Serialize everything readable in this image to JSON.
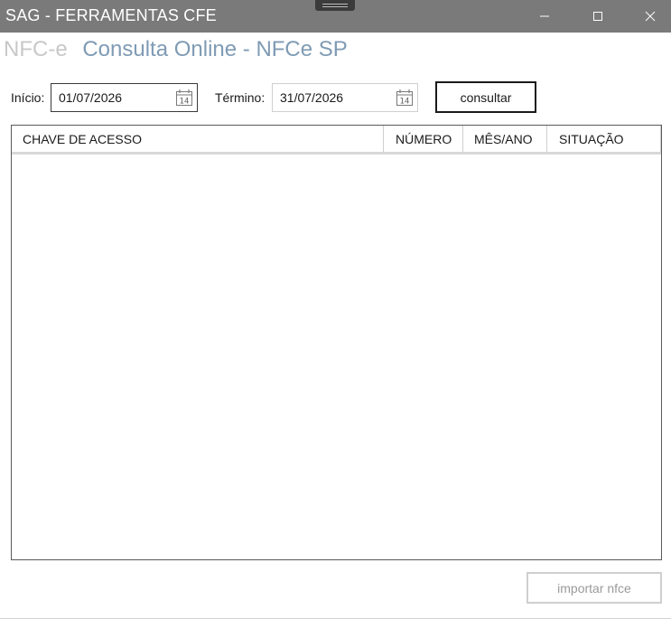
{
  "window": {
    "title": "SAG - FERRAMENTAS CFE"
  },
  "heading": {
    "prefix": "NFC-e",
    "title": "Consulta Online - NFCe SP"
  },
  "filters": {
    "start_label": "Início:",
    "start_value": "01/07/2026",
    "end_label": "Término:",
    "end_value": "31/07/2026",
    "calendar_day": "14",
    "consult_button": "consultar"
  },
  "grid": {
    "columns": [
      "CHAVE DE ACESSO",
      "NÚMERO",
      "MÊS/ANO",
      "SITUAÇÃO"
    ],
    "rows": []
  },
  "actions": {
    "import_button": "importar nfce"
  },
  "colors": {
    "titlebar": "#7a7a7a",
    "heading_prefix": "#c8c8c8",
    "heading_title": "#7f9bb4"
  }
}
